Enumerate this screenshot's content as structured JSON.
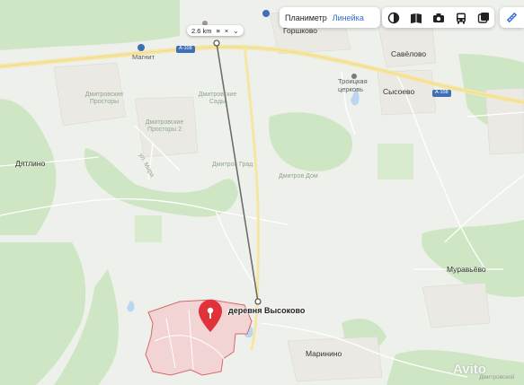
{
  "toolbar": {
    "planimeter_label": "Планиметр",
    "ruler_label": "Линейка",
    "icons": [
      "layers-icon",
      "panorama-book-icon",
      "camera-icon",
      "bus-icon",
      "transport-overlay-icon"
    ]
  },
  "measure": {
    "distance": "2.6 km",
    "menu_glyph": "≡",
    "close_glyph": "×",
    "collapse_glyph": "⌄"
  },
  "map": {
    "highway_label": "А-108",
    "places": {
      "gorshkovo": "Горшково",
      "savelovo": "Савёлово",
      "trinity_church": "Троицкая церковь",
      "sysoevo": "Сысоево",
      "magnit": "Магнит",
      "dmitrov_prostory": "Дмитровские Просторы",
      "dmitrov_prostory_2": "Дмитровские Просторы 2",
      "dmitrov_sady": "Дмитровские Сады",
      "dmitrov_grad": "Дмитров Град",
      "dmitrov_dom": "Дмитров Дом",
      "ul_mira": "ул. Мира",
      "dyatlino": "Дятлино",
      "muravyovo": "Муравьёво",
      "marinino": "Маринино",
      "vysokovo": "деревня Высоково",
      "dmitrov_bottom": "Дмитровский"
    },
    "colors": {
      "forest": "#cfe6c4",
      "field": "#eef0ec",
      "road_major": "#f6e6a3",
      "settlement": "#f2d4d4",
      "pin": "#e1323a",
      "ruler_link": "#2f6bd3",
      "shield": "#3f6fb5"
    }
  },
  "watermark": "Avito"
}
